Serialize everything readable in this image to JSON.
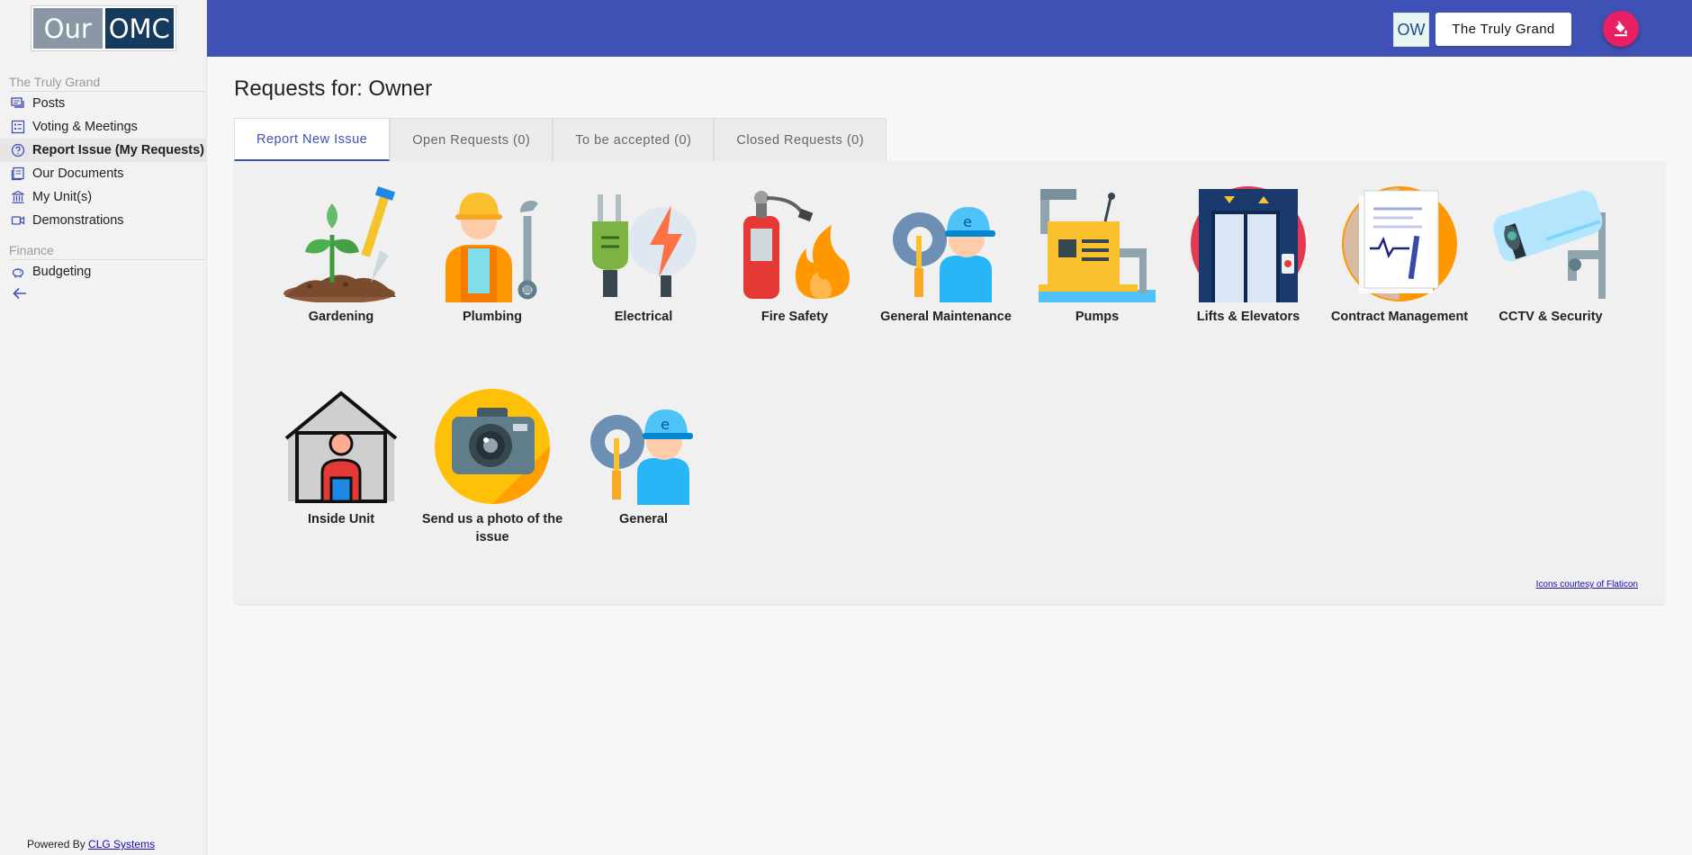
{
  "logo": {
    "part1": "Our",
    "part2": "OMC"
  },
  "sidebar": {
    "section_main": "The Truly Grand",
    "items": [
      {
        "label": "Posts",
        "icon": "posts-icon"
      },
      {
        "label": "Voting & Meetings",
        "icon": "voting-icon"
      },
      {
        "label": "Report Issue (My Requests)",
        "icon": "help-circle-icon"
      },
      {
        "label": "Our Documents",
        "icon": "documents-icon"
      },
      {
        "label": "My Unit(s)",
        "icon": "building-icon"
      },
      {
        "label": "Demonstrations",
        "icon": "video-icon"
      }
    ],
    "section_finance": "Finance",
    "finance_items": [
      {
        "label": "Budgeting",
        "icon": "piggy-bank-icon"
      }
    ],
    "powered_prefix": "Powered By",
    "powered_link": "CLG Systems"
  },
  "topbar": {
    "user_initials": "OW",
    "building_name": "The Truly Grand",
    "theme_icon": "paint-bucket-icon"
  },
  "main": {
    "title": "Requests for: Owner",
    "tabs": [
      {
        "label": "Report New Issue"
      },
      {
        "label": "Open Requests (0)"
      },
      {
        "label": "To be accepted (0)"
      },
      {
        "label": "Closed Requests (0)"
      }
    ],
    "categories": [
      {
        "label": "Gardening"
      },
      {
        "label": "Plumbing"
      },
      {
        "label": "Electrical"
      },
      {
        "label": "Fire Safety"
      },
      {
        "label": "General Maintenance"
      },
      {
        "label": "Pumps"
      },
      {
        "label": "Lifts & Elevators"
      },
      {
        "label": "Contract Management"
      },
      {
        "label": "CCTV & Security"
      },
      {
        "label": "Inside Unit"
      },
      {
        "label": "Send us a photo of the issue"
      },
      {
        "label": "General"
      }
    ],
    "credit": "Icons courtesy of Flaticon"
  },
  "colors": {
    "topbar": "#3f51b5",
    "accent": "#3f51b5",
    "fab": "#e91e63"
  }
}
